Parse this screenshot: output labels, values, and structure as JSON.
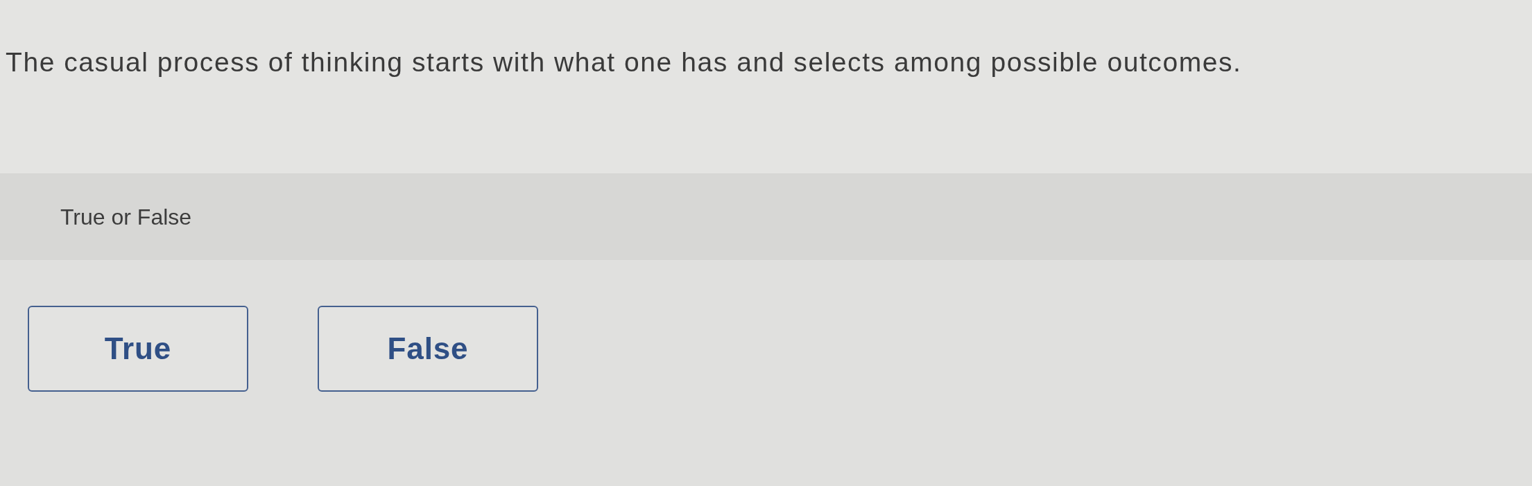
{
  "question": {
    "text": "The casual process of thinking starts with what one has and selects among possible outcomes."
  },
  "prompt": {
    "text": "True or False"
  },
  "options": [
    {
      "label": "True",
      "selected": false
    },
    {
      "label": "False",
      "selected": false
    }
  ]
}
